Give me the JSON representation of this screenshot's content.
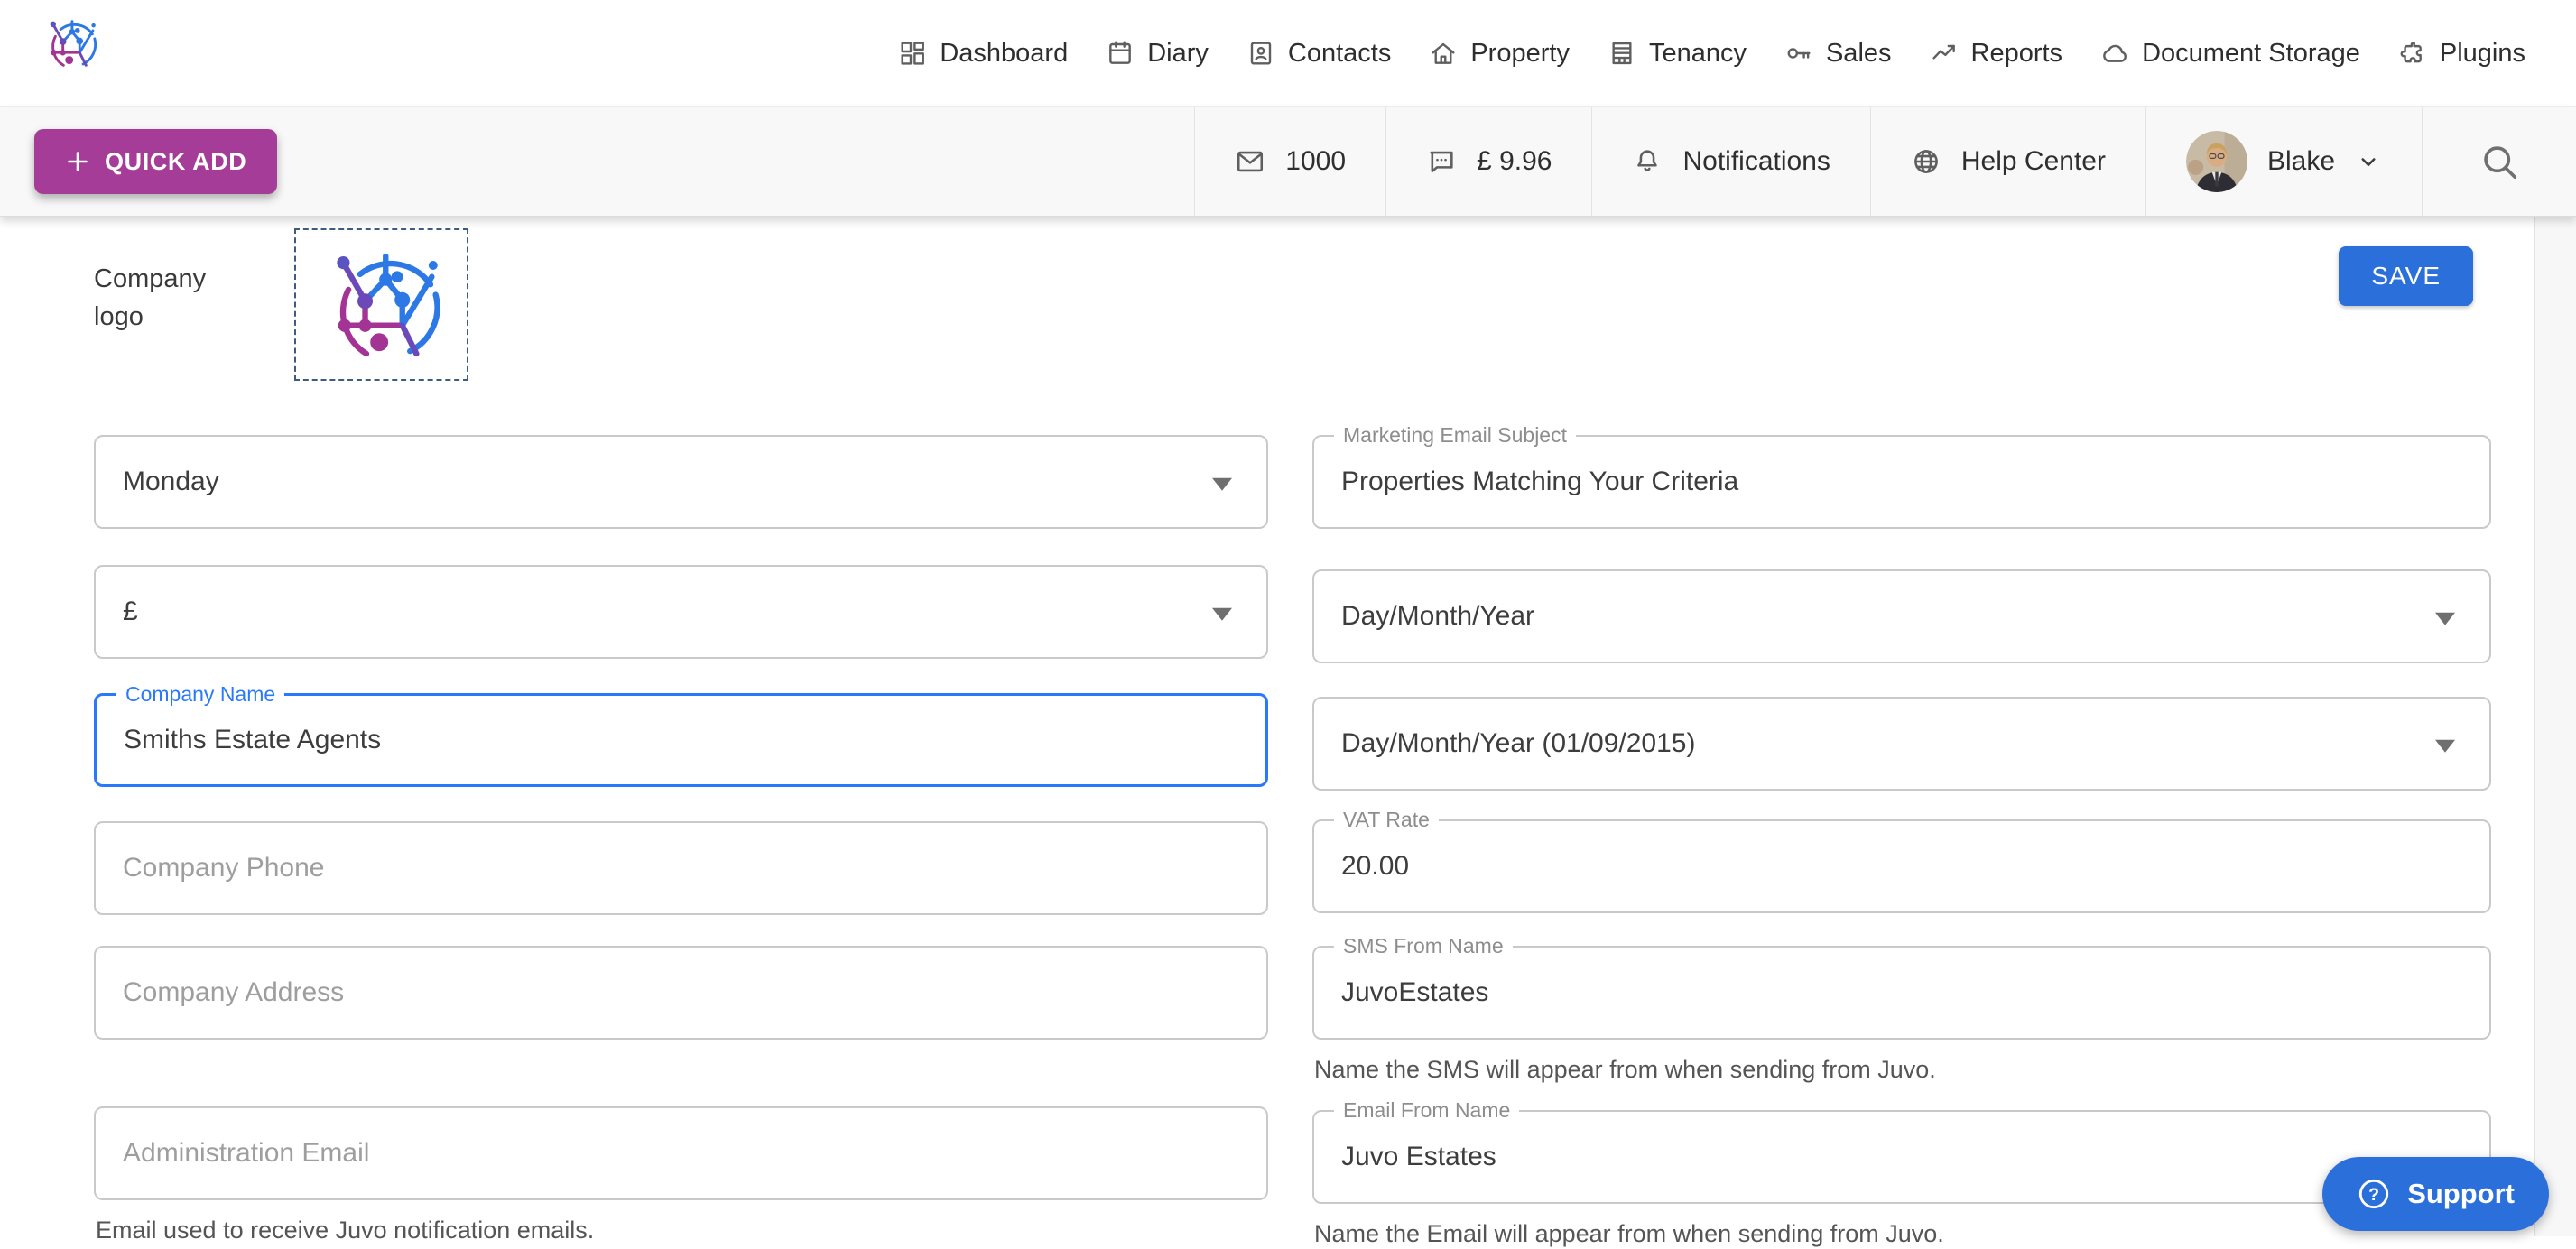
{
  "colors": {
    "accent_blue": "#2b6fdb",
    "quick_add_magenta": "#a53c97",
    "focus_blue": "#2979ff"
  },
  "nav": {
    "items": [
      {
        "label": "Dashboard",
        "icon": "dashboard-grid-icon"
      },
      {
        "label": "Diary",
        "icon": "calendar-icon"
      },
      {
        "label": "Contacts",
        "icon": "contacts-card-icon"
      },
      {
        "label": "Property",
        "icon": "house-icon"
      },
      {
        "label": "Tenancy",
        "icon": "building-icon"
      },
      {
        "label": "Sales",
        "icon": "key-icon"
      },
      {
        "label": "Reports",
        "icon": "trending-up-icon"
      },
      {
        "label": "Document Storage",
        "icon": "cloud-icon"
      },
      {
        "label": "Plugins",
        "icon": "puzzle-icon"
      }
    ]
  },
  "toolbar": {
    "quick_add_label": "QUICK ADD",
    "email_count": "1000",
    "sms_balance": "£ 9.96",
    "notifications_label": "Notifications",
    "help_label": "Help Center",
    "user_name": "Blake"
  },
  "header": {
    "company_logo_label": "Company logo",
    "save_label": "SAVE"
  },
  "content": {
    "left": {
      "week_start_value": "Monday",
      "currency_value": "£",
      "company_name": {
        "label": "Company Name",
        "value": "Smiths Estate Agents"
      },
      "company_phone_placeholder": "Company Phone",
      "company_address_placeholder": "Company Address",
      "admin_email_placeholder": "Administration Email",
      "admin_email_helper": "Email used to receive Juvo notification emails."
    },
    "right": {
      "marketing_subject": {
        "label": "Marketing Email Subject",
        "value": "Properties Matching Your Criteria"
      },
      "date_format_value": "Day/Month/Year",
      "date_example_value": "Day/Month/Year (01/09/2015)",
      "vat": {
        "label": "VAT Rate",
        "value": "20.00"
      },
      "sms_from": {
        "label": "SMS From Name",
        "value": "JuvoEstates",
        "helper": "Name the SMS will appear from when sending from Juvo."
      },
      "email_from": {
        "label": "Email From Name",
        "value": "Juvo Estates",
        "helper": "Name the Email will appear from when sending from Juvo."
      }
    }
  },
  "support": {
    "label": "Support"
  }
}
